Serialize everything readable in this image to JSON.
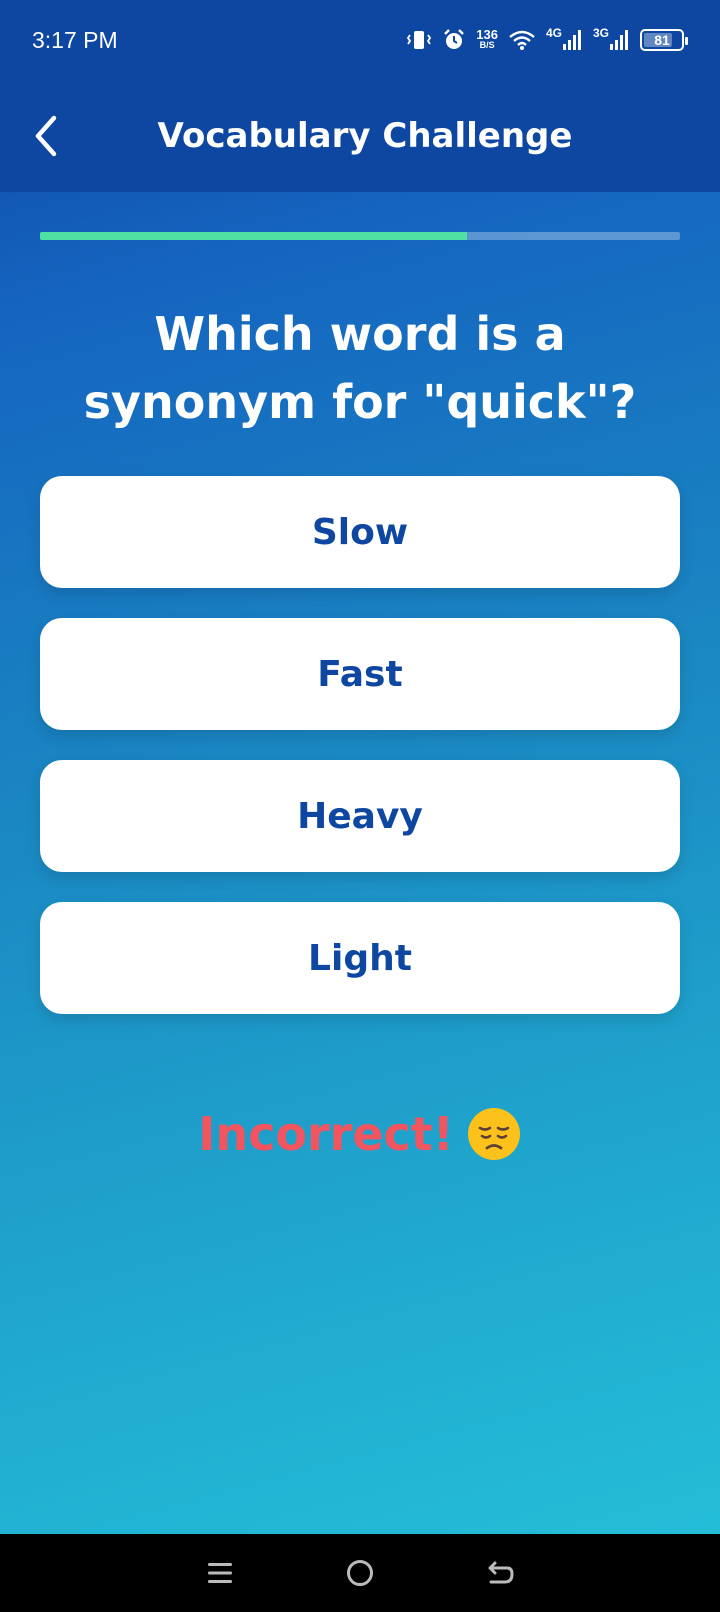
{
  "status_bar": {
    "time": "3:17 PM",
    "net_speed_value": "136",
    "net_speed_unit": "B/S",
    "signal1_label": "4G",
    "signal2_label": "3G",
    "battery_level": "81",
    "icons": [
      "vibrate-icon",
      "alarm-icon",
      "wifi-icon",
      "signal-icon",
      "battery-icon"
    ]
  },
  "app_bar": {
    "title": "Vocabulary Challenge",
    "back_icon": "back-arrow-icon"
  },
  "progress": {
    "fraction": 0.667,
    "fill_color": "#4ee1a3",
    "track_color": "rgba(255,255,255,0.3)"
  },
  "question": {
    "text": "Which word is a synonym for \"quick\"?"
  },
  "options": [
    {
      "label": "Slow"
    },
    {
      "label": "Fast"
    },
    {
      "label": "Heavy"
    },
    {
      "label": "Light"
    }
  ],
  "feedback": {
    "text": "Incorrect!",
    "emoji": "pensive-face-icon",
    "color": "#f25560"
  },
  "nav_bar": {
    "icons": [
      "menu-icon",
      "home-icon",
      "back-icon"
    ]
  },
  "colors": {
    "primary": "#0d47a1",
    "gradient_end": "#25c2da",
    "option_bg": "#ffffff"
  }
}
